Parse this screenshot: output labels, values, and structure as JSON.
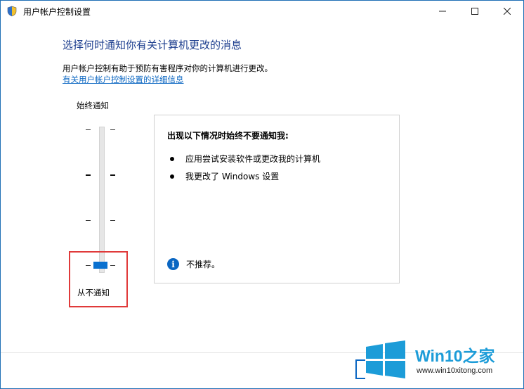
{
  "window": {
    "title": "用户帐户控制设置",
    "buttons": {
      "minimize": "minimize-icon",
      "maximize": "maximize-icon",
      "close": "close-icon"
    }
  },
  "main": {
    "heading": "选择何时通知你有关计算机更改的消息",
    "description": "用户帐户控制有助于预防有害程序对你的计算机进行更改。",
    "link": "有关用户帐户控制设置的详细信息"
  },
  "slider": {
    "top_label": "始终通知",
    "bottom_label": "从不通知",
    "levels": 4,
    "selected_level": 1
  },
  "panel": {
    "title": "出现以下情况时始终不要通知我:",
    "bullets": [
      "应用尝试安装软件或更改我的计算机",
      "我更改了 Windows 设置"
    ],
    "info_icon": "info-icon",
    "info_text": "不推荐。"
  },
  "watermark": {
    "brand": "Win10之家",
    "url": "www.win10xitong.com"
  },
  "colors": {
    "accent": "#0a71d0",
    "heading": "#1e3f8f",
    "link": "#0a66c2",
    "highlight": "#e03a3a"
  }
}
